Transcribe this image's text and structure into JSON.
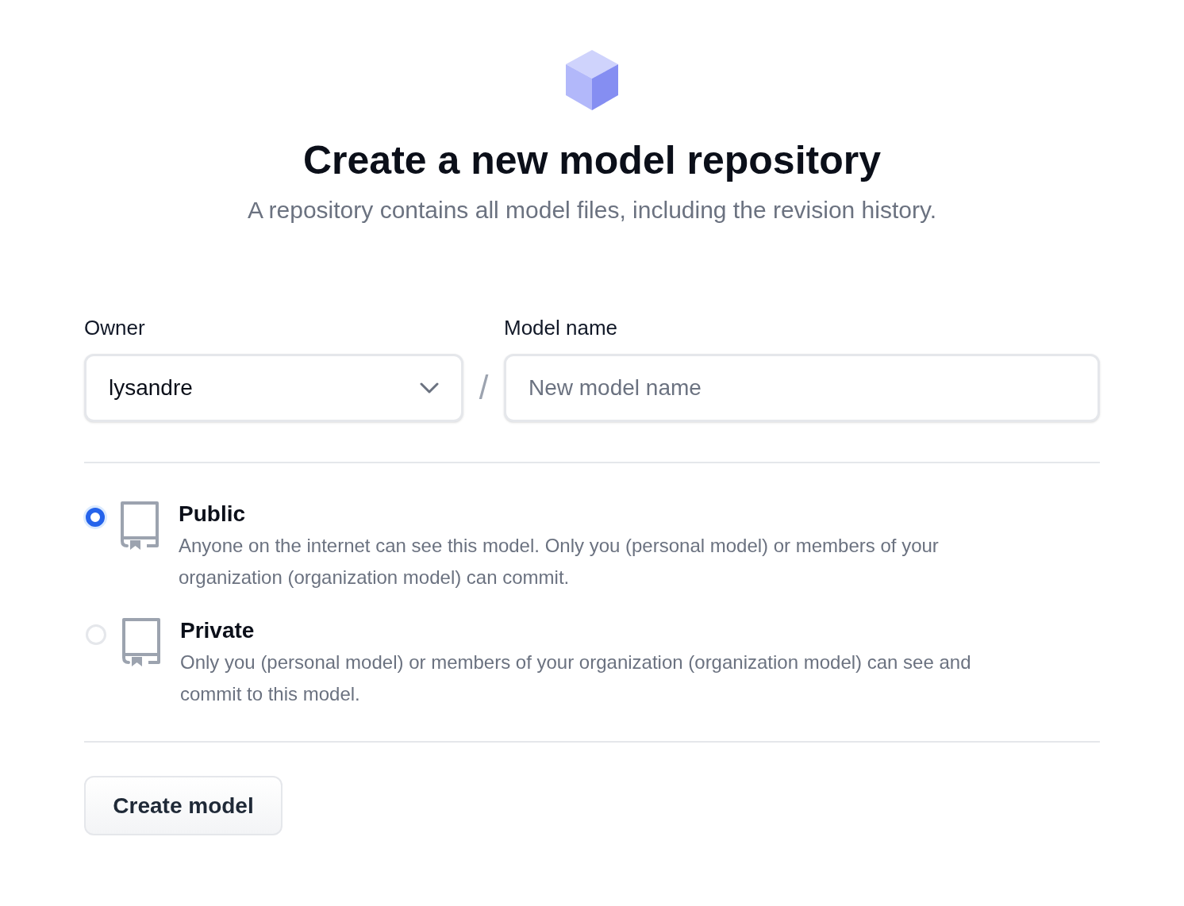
{
  "header": {
    "title": "Create a new model repository",
    "subtitle": "A repository contains all model files, including the revision history."
  },
  "form": {
    "owner": {
      "label": "Owner",
      "value": "lysandre"
    },
    "separator": "/",
    "model_name": {
      "label": "Model name",
      "placeholder": "New model name"
    }
  },
  "visibility_options": [
    {
      "title": "Public",
      "description": "Anyone on the internet can see this model. Only you (personal model) or members of your organization (organization model) can commit.",
      "selected": true
    },
    {
      "title": "Private",
      "description": "Only you (personal model) or members of your organization (organization model) can see and commit to this model.",
      "selected": false
    }
  ],
  "submit_button": "Create model"
}
